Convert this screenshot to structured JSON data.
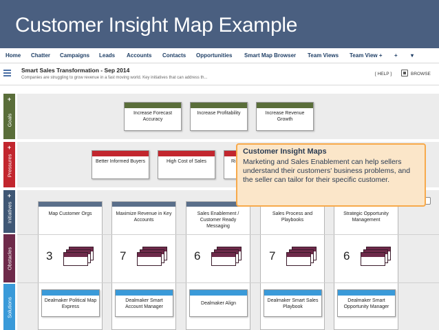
{
  "slide": {
    "title": "Customer Insight Map Example"
  },
  "nav": {
    "items": [
      "Home",
      "Chatter",
      "Campaigns",
      "Leads",
      "Accounts",
      "Contacts",
      "Opportunities",
      "Smart Map Browser",
      "Team Views",
      "Team View +",
      "+",
      "▾"
    ]
  },
  "map": {
    "title": "Smart Sales Transformation - Sep 2014",
    "subtitle": "Companies are struggling to grow revenue in a fast moving world. Key initiatives that can address th...",
    "help": "[ HELP ]",
    "browse": "BROWSE"
  },
  "rows": {
    "goals": {
      "label": "Goals",
      "plus": "+",
      "color": "#5a6e3a"
    },
    "pressures": {
      "label": "Pressures",
      "plus": "+",
      "color": "#c2262e"
    },
    "initiatives": {
      "label": "Initiatives",
      "plus": "+",
      "color": "#3f5775"
    },
    "obstacles": {
      "label": "Obstacles",
      "color": "#6e2a4a"
    },
    "solutions": {
      "label": "Solutions",
      "color": "#3a9ad9"
    }
  },
  "goals": [
    "Increase Forecast Accuracy",
    "Increase Profitability",
    "Increase Revenue Growth"
  ],
  "pressures": [
    "Better Informed Buyers",
    "High Cost of Sales",
    "Ri"
  ],
  "initiatives": [
    "Map Customer Orgs",
    "Maximize Revenue in Key Accounts",
    "Sales Enablement / Customer Ready Messaging",
    "Sales Process and Playbooks",
    "Strategic Opportunity Management"
  ],
  "obstacles": [
    "3",
    "7",
    "6",
    "7",
    "6"
  ],
  "solutions": [
    "Dealmaker Political Map Express",
    "Dealmaker Smart Account Manager",
    "Dealmaker Align",
    "Dealmaker Smart Sales Playbook",
    "Dealmaker Smart Opportunity Manager"
  ],
  "callout": {
    "title": "Customer Insight Maps",
    "body": "Marketing and Sales Enablement can help sellers understand their customers' business problems, and the seller can tailor for their specific customer."
  },
  "colors": {
    "header": "#4a5f80",
    "callout_border": "#f7a94a",
    "callout_bg": "#fbe6c9"
  }
}
